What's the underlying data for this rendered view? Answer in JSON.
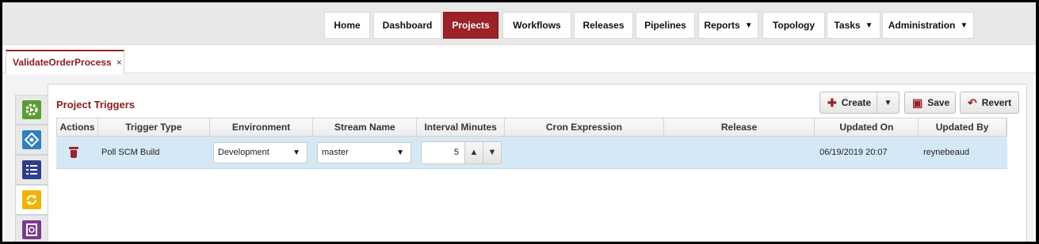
{
  "nav": {
    "home": "Home",
    "dashboard": "Dashboard",
    "projects": "Projects",
    "workflows": "Workflows",
    "releases": "Releases",
    "pipelines": "Pipelines",
    "reports": "Reports",
    "topology": "Topology",
    "tasks": "Tasks",
    "administration": "Administration",
    "active_color": "#9b2226"
  },
  "tab": {
    "label": "ValidateOrderProcess",
    "close": "×"
  },
  "side_tools": [
    {
      "icon": "gear-play-icon",
      "color": "#5a9e2f"
    },
    {
      "icon": "network-icon",
      "color": "#2f7fc1"
    },
    {
      "icon": "list-icon",
      "color": "#2e3e8c"
    },
    {
      "icon": "refresh-icon",
      "color": "#f0b400"
    },
    {
      "icon": "clipboard-search-icon",
      "color": "#7a3b8f"
    }
  ],
  "panel": {
    "title": "Project Triggers",
    "create": "Create",
    "save": "Save",
    "revert": "Revert"
  },
  "grid": {
    "headers": {
      "actions": "Actions",
      "trigger_type": "Trigger Type",
      "environment": "Environment",
      "stream_name": "Stream Name",
      "interval": "Interval Minutes",
      "cron": "Cron Expression",
      "release": "Release",
      "updated_on": "Updated On",
      "updated_by": "Updated By"
    },
    "row": {
      "trigger_type": "Poll SCM Build",
      "environment": "Development",
      "stream_name": "master",
      "interval": "5",
      "cron": "",
      "release": "",
      "updated_on": "06/19/2019 20:07",
      "updated_by": "reynebeaud"
    }
  }
}
